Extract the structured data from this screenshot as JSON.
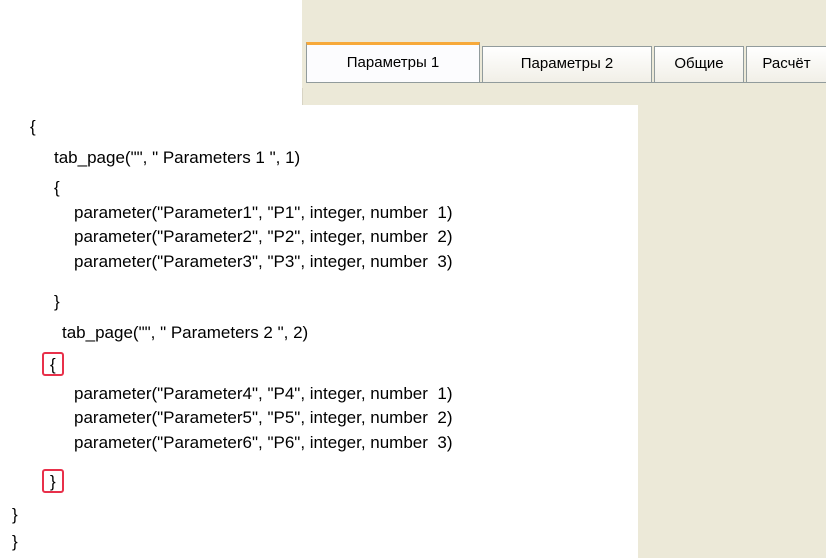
{
  "tabs": [
    {
      "label": "Параметры 1"
    },
    {
      "label": "Параметры 2"
    },
    {
      "label": "Общие"
    },
    {
      "label": "Расчёт"
    }
  ],
  "code_lines": [
    "{",
    "tab_page(\"\", \" Parameters 1 \", 1)",
    "{",
    "parameter(\"Parameter1\", \"P1\", integer, number  1)",
    "parameter(\"Parameter2\", \"P2\", integer, number  2)",
    "parameter(\"Parameter3\", \"P3\", integer, number  3)",
    "}",
    "tab_page(\"\", \" Parameters 2 \", 2)",
    "{",
    "parameter(\"Parameter4\", \"P4\", integer, number  1)",
    "parameter(\"Parameter5\", \"P5\", integer, number  2)",
    "parameter(\"Parameter6\", \"P6\", integer, number  3)",
    "}",
    "}",
    "}"
  ],
  "highlight_color": "#e8304a"
}
